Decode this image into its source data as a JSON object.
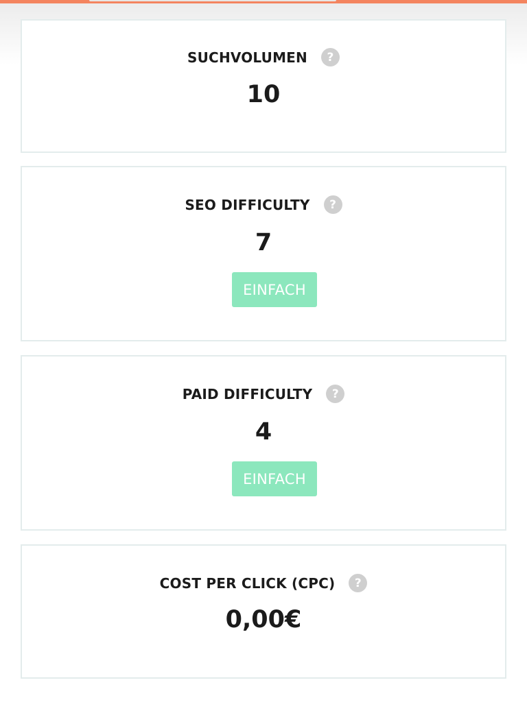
{
  "colors": {
    "accent_top_bar": "#f4845f",
    "badge_easy": "#8ce7bd",
    "card_border": "#e3ecec",
    "help_icon": "#cfcfcf"
  },
  "cards": [
    {
      "title": "SUCHVOLUMEN",
      "value": "10",
      "help_icon": "question-mark"
    },
    {
      "title": "SEO DIFFICULTY",
      "value": "7",
      "badge": "EINFACH",
      "help_icon": "question-mark"
    },
    {
      "title": "PAID DIFFICULTY",
      "value": "4",
      "badge": "EINFACH",
      "help_icon": "question-mark"
    },
    {
      "title": "COST PER CLICK (CPC)",
      "value": "0,00€",
      "help_icon": "question-mark"
    }
  ],
  "help_glyph": "?"
}
